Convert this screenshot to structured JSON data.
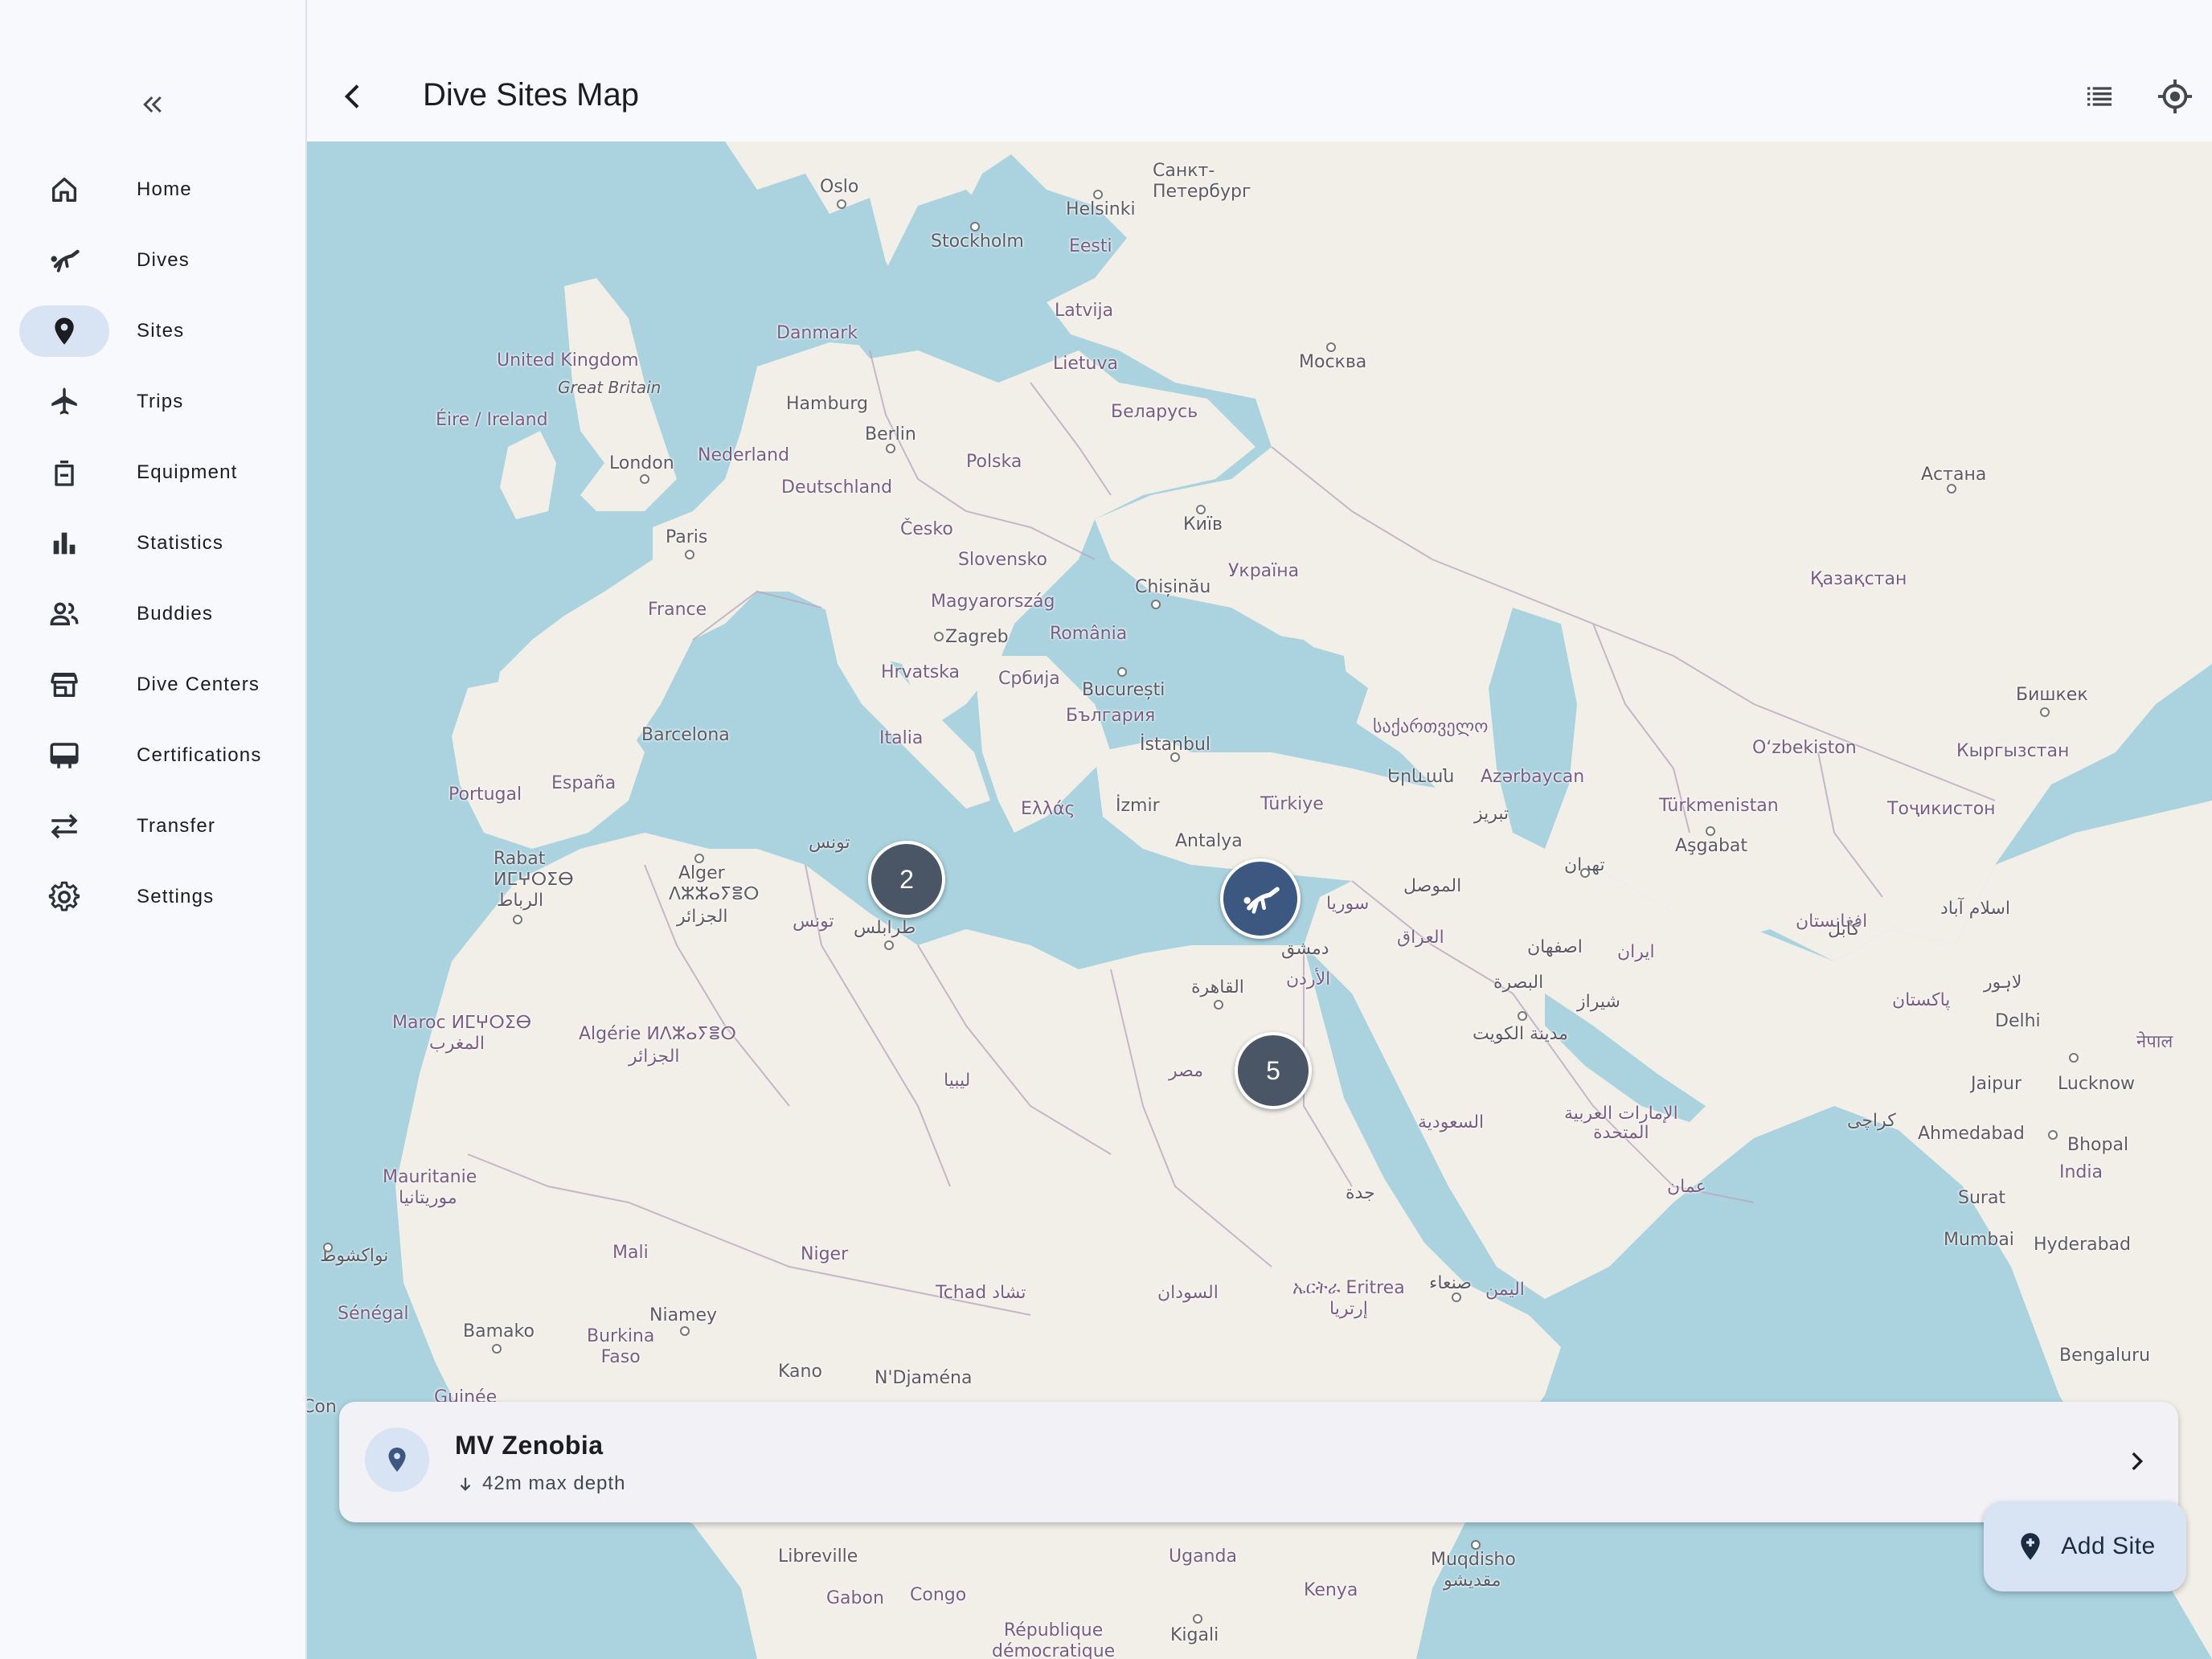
{
  "header": {
    "title": "Dive Sites Map"
  },
  "sidebar": {
    "items": [
      {
        "label": "Home",
        "icon": "home-icon"
      },
      {
        "label": "Dives",
        "icon": "diver-icon"
      },
      {
        "label": "Sites",
        "icon": "location-pin-icon",
        "active": true
      },
      {
        "label": "Trips",
        "icon": "airplane-icon"
      },
      {
        "label": "Equipment",
        "icon": "backpack-icon"
      },
      {
        "label": "Statistics",
        "icon": "bar-chart-icon"
      },
      {
        "label": "Buddies",
        "icon": "people-icon"
      },
      {
        "label": "Dive Centers",
        "icon": "storefront-icon"
      },
      {
        "label": "Certifications",
        "icon": "card-icon"
      },
      {
        "label": "Transfer",
        "icon": "swap-arrows-icon"
      },
      {
        "label": "Settings",
        "icon": "gear-icon"
      }
    ]
  },
  "map": {
    "clusters": [
      {
        "count": "2"
      },
      {
        "count": "5"
      }
    ],
    "labels": {
      "oslo": "Oslo",
      "stockholm": "Stockholm",
      "helsinki": "Helsinki",
      "spb": "Санкт-\nПетербург",
      "eesti": "Eesti",
      "latvija": "Latvija",
      "lietuva": "Lietuva",
      "moskva": "Москва",
      "danmark": "Danmark",
      "uk": "United Kingdom",
      "gb": "Great Britain",
      "eire": "Éire / Ireland",
      "hamburg": "Hamburg",
      "berlin": "Berlin",
      "belarus": "Беларусь",
      "london": "London",
      "nederland": "Nederland",
      "polska": "Polska",
      "deutschland": "Deutschland",
      "paris": "Paris",
      "cesko": "Česko",
      "kyiv": "Київ",
      "astana": "Астана",
      "slovensko": "Slovensko",
      "ukraina": "Україна",
      "kazakhstan": "Қазақстан",
      "france": "France",
      "chisinau": "Chișinău",
      "magyar": "Magyarország",
      "zagreb": "Zagreb",
      "romania": "România",
      "hrvatska": "Hrvatska",
      "srbija": "Србија",
      "bucuresti": "București",
      "bulgaria": "България",
      "bishkek": "Бишкек",
      "barcelona": "Barcelona",
      "italia": "Italia",
      "istanbul": "İstanbul",
      "georgia": "საქართველო",
      "uzbekistan": "Oʻzbekiston",
      "kyrgyzstan": "Кыргызстан",
      "portugal": "Portugal",
      "espana": "España",
      "yerevan": "Երևան",
      "azerbaycan": "Azərbaycan",
      "turkmenistan": "Türkmenistan",
      "tojikiston": "Тоҷикистон",
      "ellas": "Ελλάς",
      "izmir": "İzmir",
      "turkiye": "Türkiye",
      "tabriz": "تبریز",
      "ashgabat": "Aşgabat",
      "rabat": "Rabat",
      "alger": "Alger",
      "tunis": "تونس",
      "antalya": "Antalya",
      "tehran": "تهران",
      "morocco_tif": "ⵍⵎⵖⵔⵉⴱ",
      "algeria_tif": "ⴷⵣⵣⴰⵢⴻⵔ",
      "mosul": "الموصل",
      "syria": "سوريا",
      "afghanistan": "افغانستان",
      "islamabad": "اسلام آباد",
      "rabat_ar": "الرباط",
      "aljazair": "الجزائر",
      "tunis2": "تونس",
      "tripoli": "طرابلس",
      "dimashq": "دمشق",
      "iraq": "العراق",
      "isfahan": "اصفهان",
      "iran": "ایران",
      "kabul": "کابل",
      "urdun": "الأردن",
      "cairo": "القاهرة",
      "basra": "البصرة",
      "lahore": "لاہور",
      "pakistan": "پاکستان",
      "maroc": "Maroc ⵍⵎⵖⵔⵉⴱ",
      "maghrib": "المغرب",
      "algerie": "Algérie ⵍⴷⵣⴰⵢⴻⵔ",
      "jazair2": "الجزائر",
      "kuwait": "مدينة الكويت",
      "shiraz": "شیراز",
      "delhi": "Delhi",
      "nepal": "नेपाल",
      "libya": "ليبيا",
      "misr": "مصر",
      "jaipur": "Jaipur",
      "lucknow": "Lucknow",
      "uae": "الإمارات العربية\nالمتحدة",
      "karachi": "کراچی",
      "saudi": "السعودية",
      "ahmedabad": "Ahmedabad",
      "bhopal": "Bhopal",
      "india": "India",
      "mauritanie": "Mauritanie",
      "muritaniya": "موريتانيا",
      "jeddah": "جدة",
      "oman": "عمان",
      "surat": "Surat",
      "nouakchott": "نواكشوط",
      "mali": "Mali",
      "niger": "Niger",
      "mumbai": "Mumbai",
      "hyderabad": "Hyderabad",
      "tchad": "Tchad تشاد",
      "sudan": "السودان",
      "eritrea": "ኤርትራ Eritrea",
      "eritrea_ar": "إرتريا",
      "sanaa": "صنعاء",
      "yemen": "اليمن",
      "senegal": "Sénégal",
      "niamey": "Niamey",
      "bamako": "Bamako",
      "burkina": "Burkina\nFaso",
      "kano": "Kano",
      "ndjamena": "N'Djaména",
      "bengaluru": "Bengaluru",
      "libreville": "Libreville",
      "uganda": "Uganda",
      "mogadishu": "Muqdisho",
      "mogadishu_ar": "مقديشو",
      "gabon": "Gabon",
      "congo": "Congo",
      "kenya": "Kenya",
      "rdc": "République\ndémocratique",
      "kigali": "Kigali",
      "con": "Con",
      "guinee": "Guinée"
    }
  },
  "site_card": {
    "name": "MV Zenobia",
    "depth": "42m max depth"
  },
  "fab": {
    "label": "Add Site"
  },
  "colors": {
    "water": "#aad3df",
    "land": "#f2efe9",
    "marker": "#3c5880",
    "cluster": "#4a5565",
    "accent_container": "#d8e3f4"
  }
}
